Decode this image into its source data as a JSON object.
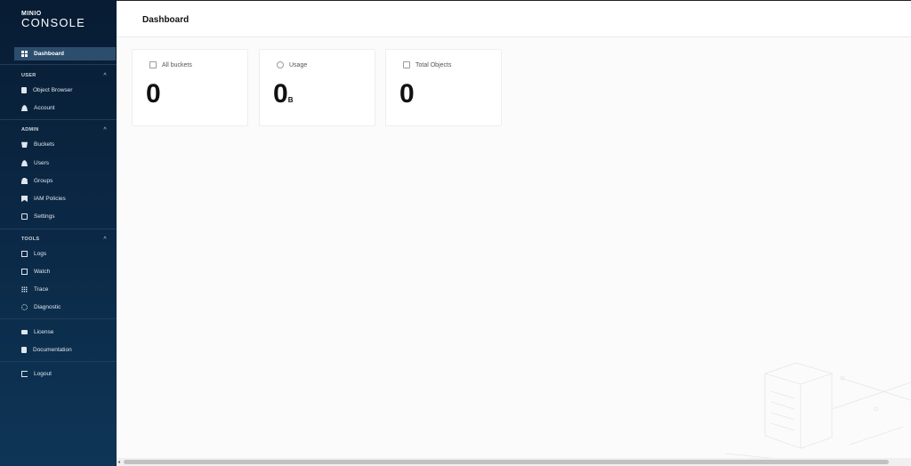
{
  "logo": {
    "top": "MINIO",
    "main": "CONSOLE"
  },
  "nav": {
    "dashboard": "Dashboard",
    "user_section": "USER",
    "object_browser": "Object Browser",
    "account": "Account",
    "admin_section": "ADMIN",
    "buckets": "Buckets",
    "users": "Users",
    "groups": "Groups",
    "iam_policies": "IAM Policies",
    "settings": "Settings",
    "tools_section": "TOOLS",
    "logs": "Logs",
    "watch": "Watch",
    "trace": "Trace",
    "diagnostic": "Diagnostic",
    "license": "License",
    "documentation": "Documentation",
    "logout": "Logout"
  },
  "header": {
    "title": "Dashboard"
  },
  "cards": [
    {
      "label": "All buckets",
      "value": "0",
      "unit": "",
      "icon": "buckets-icon"
    },
    {
      "label": "Usage",
      "value": "0",
      "unit": "B",
      "icon": "usage-icon"
    },
    {
      "label": "Total Objects",
      "value": "0",
      "unit": "",
      "icon": "objects-icon"
    }
  ],
  "colors": {
    "sidebar": "#0b2a48",
    "active": "#2d4d6d",
    "background": "#fbfbfb"
  }
}
